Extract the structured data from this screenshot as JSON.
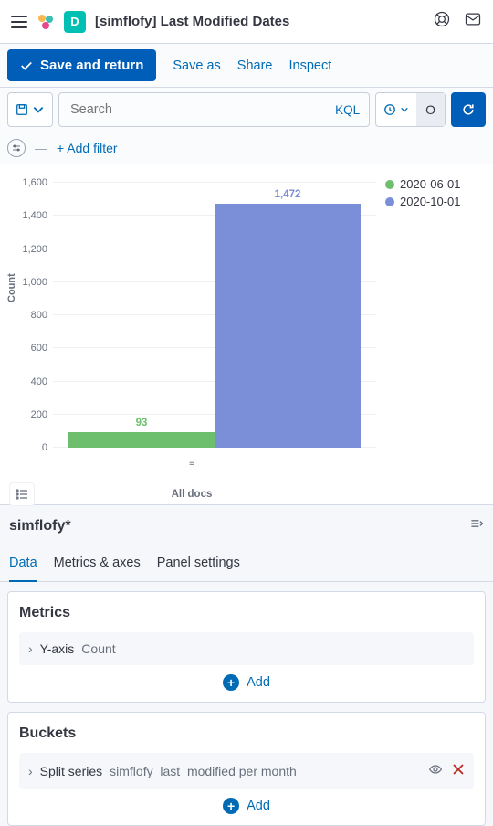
{
  "header": {
    "badge_letter": "D",
    "title": "[simflofy] Last Modified Dates"
  },
  "actions": {
    "save_return": "Save and return",
    "save_as": "Save as",
    "share": "Share",
    "inspect": "Inspect"
  },
  "query": {
    "search_placeholder": "Search",
    "lang": "KQL",
    "time_short": "O",
    "add_filter": "+ Add filter"
  },
  "chart_data": {
    "type": "bar",
    "title": "",
    "categories": [
      "All docs"
    ],
    "series": [
      {
        "name": "2020-06-01",
        "color": "#6dbe6d",
        "values": [
          93
        ]
      },
      {
        "name": "2020-10-01",
        "color": "#7b8ed8",
        "values": [
          1472
        ]
      }
    ],
    "ylabel": "Count",
    "xlabel": "All docs",
    "ylim": [
      0,
      1600
    ],
    "yticks": [
      0,
      200,
      400,
      600,
      800,
      1000,
      1200,
      1400,
      1600
    ],
    "value_labels": [
      "93",
      "1,472"
    ]
  },
  "panel": {
    "index_pattern": "simflofy*",
    "tabs": [
      "Data",
      "Metrics & axes",
      "Panel settings"
    ],
    "metrics": {
      "title": "Metrics",
      "row_label": "Y-axis",
      "row_value": "Count",
      "add": "Add"
    },
    "buckets": {
      "title": "Buckets",
      "row_label": "Split series",
      "row_value": "simflofy_last_modified per month",
      "add": "Add"
    }
  }
}
